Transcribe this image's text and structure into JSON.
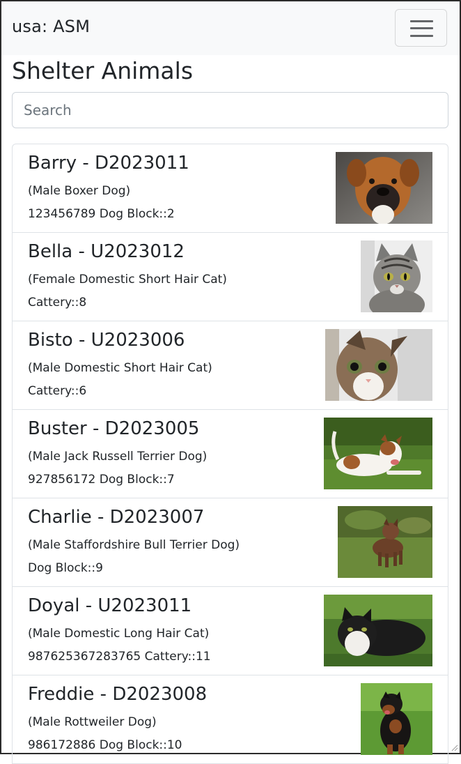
{
  "navbar": {
    "brand": "usa: ASM",
    "toggle_icon": "hamburger-menu-icon"
  },
  "page": {
    "title": "Shelter Animals"
  },
  "search": {
    "placeholder": "Search",
    "value": ""
  },
  "animals": [
    {
      "name": "Barry - D2023011",
      "description": "(Male Boxer Dog)",
      "location": "123456789 Dog Block::2",
      "photo": "boxer-dog-photo"
    },
    {
      "name": "Bella - U2023012",
      "description": "(Female Domestic Short Hair Cat)",
      "location": "Cattery::8",
      "photo": "tabby-cat-photo"
    },
    {
      "name": "Bisto - U2023006",
      "description": "(Male Domestic Short Hair Cat)",
      "location": "Cattery::6",
      "photo": "kitten-peeking-photo"
    },
    {
      "name": "Buster - D2023005",
      "description": "(Male Jack Russell Terrier Dog)",
      "location": "927856172 Dog Block::7",
      "photo": "jack-russell-photo"
    },
    {
      "name": "Charlie - D2023007",
      "description": "(Male Staffordshire Bull Terrier Dog)",
      "location": "Dog Block::9",
      "photo": "staffy-photo"
    },
    {
      "name": "Doyal - U2023011",
      "description": "(Male Domestic Long Hair Cat)",
      "location": "987625367283765 Cattery::11",
      "photo": "longhair-cat-photo"
    },
    {
      "name": "Freddie - D2023008",
      "description": "(Male Rottweiler Dog)",
      "location": "986172886 Dog Block::10",
      "photo": "rottweiler-photo"
    }
  ]
}
